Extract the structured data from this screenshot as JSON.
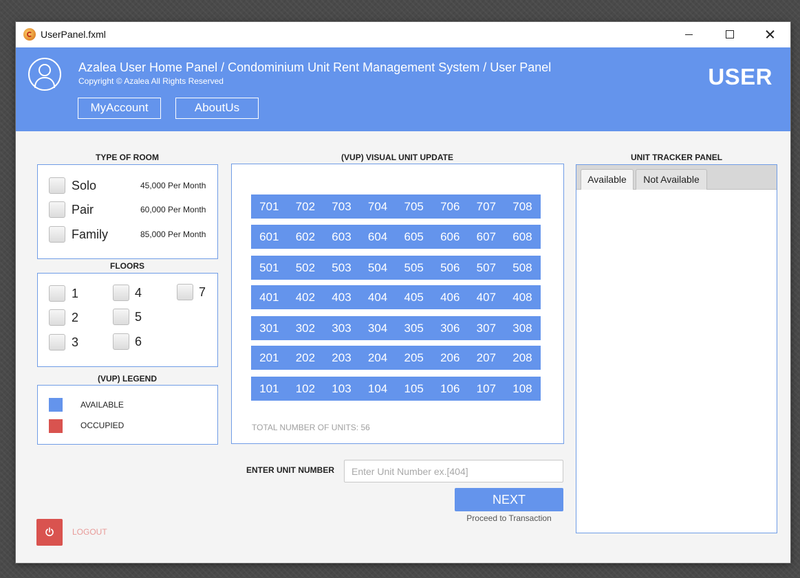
{
  "window": {
    "title": "UserPanel.fxml",
    "icon": "app-icon",
    "controls": {
      "minimize": "minimize-icon",
      "maximize": "maximize-icon",
      "close": "close-icon"
    }
  },
  "header": {
    "title": "Azalea User Home Panel / Condominium Unit Rent Management System / User Panel",
    "copyright": "Copyright © Azalea All Rights Reserved",
    "buttons": {
      "my_account": "MyAccount",
      "about_us": "AboutUs"
    },
    "role": "USER",
    "avatar_icon": "user-avatar-icon"
  },
  "room_types": {
    "title": "TYPE OF ROOM",
    "options": [
      {
        "label": "Solo",
        "price": "45,000 Per Month"
      },
      {
        "label": "Pair",
        "price": "60,000 Per Month"
      },
      {
        "label": "Family",
        "price": "85,000 Per Month"
      }
    ]
  },
  "floors": {
    "title": "FLOORS",
    "options": [
      "1",
      "2",
      "3",
      "4",
      "5",
      "6",
      "7"
    ]
  },
  "legend": {
    "title": "(VUP) LEGEND",
    "items": [
      {
        "label": "AVAILABLE",
        "color": "#6494ec"
      },
      {
        "label": "OCCUPIED",
        "color": "#d9534f"
      }
    ]
  },
  "vup": {
    "title": "(VUP) VISUAL UNIT UPDATE",
    "rows": [
      [
        "701",
        "702",
        "703",
        "704",
        "705",
        "706",
        "707",
        "708"
      ],
      [
        "601",
        "602",
        "603",
        "604",
        "605",
        "606",
        "607",
        "608"
      ],
      [
        "501",
        "502",
        "503",
        "504",
        "505",
        "506",
        "507",
        "508"
      ],
      [
        "401",
        "402",
        "403",
        "404",
        "405",
        "406",
        "407",
        "408"
      ],
      [
        "301",
        "302",
        "303",
        "304",
        "305",
        "306",
        "307",
        "308"
      ],
      [
        "201",
        "202",
        "203",
        "204",
        "205",
        "206",
        "207",
        "208"
      ],
      [
        "101",
        "102",
        "103",
        "104",
        "105",
        "106",
        "107",
        "108"
      ]
    ],
    "total": "TOTAL NUMBER OF UNITS: 56"
  },
  "entry": {
    "label": "ENTER UNIT NUMBER",
    "placeholder": "Enter Unit Number ex.[404]",
    "value": "",
    "next_label": "NEXT",
    "next_hint": "Proceed to Transaction"
  },
  "tracker": {
    "title": "UNIT TRACKER PANEL",
    "tabs": [
      "Available",
      "Not Available"
    ],
    "selected_tab": "Available"
  },
  "logout": {
    "label": "LOGOUT",
    "icon": "power-icon"
  },
  "colors": {
    "accent": "#6494ec",
    "danger": "#d9534f"
  }
}
